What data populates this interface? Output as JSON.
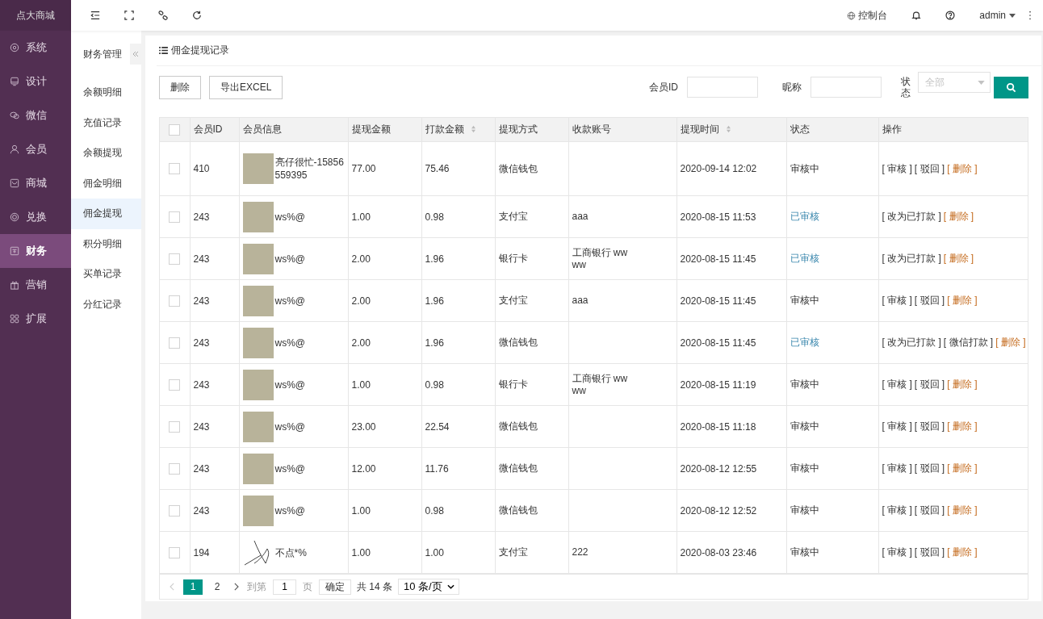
{
  "app": {
    "logo": "点大商城"
  },
  "sidebar": {
    "items": [
      {
        "label": "系统",
        "selected": false
      },
      {
        "label": "设计",
        "selected": false
      },
      {
        "label": "微信",
        "selected": false
      },
      {
        "label": "会员",
        "selected": false
      },
      {
        "label": "商城",
        "selected": false
      },
      {
        "label": "兑换",
        "selected": false
      },
      {
        "label": "财务",
        "selected": true
      },
      {
        "label": "营销",
        "selected": false
      },
      {
        "label": "扩展",
        "selected": false
      }
    ]
  },
  "subnav": {
    "title": "财务管理",
    "items": [
      {
        "label": "余额明细",
        "selected": false
      },
      {
        "label": "充值记录",
        "selected": false
      },
      {
        "label": "余额提现",
        "selected": false
      },
      {
        "label": "佣金明细",
        "selected": false
      },
      {
        "label": "佣金提现",
        "selected": true
      },
      {
        "label": "积分明细",
        "selected": false
      },
      {
        "label": "买单记录",
        "selected": false
      },
      {
        "label": "分红记录",
        "selected": false
      }
    ]
  },
  "topbar": {
    "console": "控制台",
    "user": "admin"
  },
  "page": {
    "title": "佣金提现记录",
    "buttons": [
      "删除",
      "导出EXCEL"
    ],
    "filters": {
      "member_id_label": "会员ID",
      "nickname_label": "昵称",
      "status_label": "状态",
      "status_placeholder": "全部"
    },
    "table": {
      "select_all_checked": false,
      "columns": [
        {
          "label": "会员ID",
          "sortable": false
        },
        {
          "label": "会员信息",
          "sortable": false
        },
        {
          "label": "提现金额",
          "sortable": false
        },
        {
          "label": "打款金额",
          "sortable": true
        },
        {
          "label": "提现方式",
          "sortable": false
        },
        {
          "label": "收款账号",
          "sortable": false
        },
        {
          "label": "提现时间",
          "sortable": true
        },
        {
          "label": "状态",
          "sortable": false
        },
        {
          "label": "操作",
          "sortable": false
        }
      ],
      "rows": [
        {
          "checked": false,
          "member_id": "410",
          "avatar": {
            "kind": "photo"
          },
          "nickname": "亮仔很忙-15856559395",
          "amount": "77.00",
          "paid": "75.46",
          "method": "微信钱包",
          "account": "",
          "time": "2020-09-14 12:02",
          "status": {
            "text": "审核中",
            "kind": "pending"
          },
          "actions": [
            {
              "label": "[ 审核 ]",
              "kind": "normal"
            },
            {
              "label": "[ 驳回 ]",
              "kind": "normal"
            },
            {
              "label": "[ 删除 ]",
              "kind": "danger"
            }
          ]
        },
        {
          "checked": false,
          "member_id": "243",
          "avatar": {
            "kind": "photo"
          },
          "nickname": "ws%@",
          "amount": "1.00",
          "paid": "0.98",
          "method": "支付宝",
          "account": "aaa",
          "time": "2020-08-15 11:53",
          "status": {
            "text": "已审核",
            "kind": "approved"
          },
          "actions": [
            {
              "label": "[ 改为已打款 ]",
              "kind": "normal"
            },
            {
              "label": "[ 删除 ]",
              "kind": "danger"
            }
          ]
        },
        {
          "checked": false,
          "member_id": "243",
          "avatar": {
            "kind": "photo"
          },
          "nickname": "ws%@",
          "amount": "2.00",
          "paid": "1.96",
          "method": "银行卡",
          "account": "工商银行 ww\nww",
          "time": "2020-08-15 11:45",
          "status": {
            "text": "已审核",
            "kind": "approved"
          },
          "actions": [
            {
              "label": "[ 改为已打款 ]",
              "kind": "normal"
            },
            {
              "label": "[ 删除 ]",
              "kind": "danger"
            }
          ]
        },
        {
          "checked": false,
          "member_id": "243",
          "avatar": {
            "kind": "photo"
          },
          "nickname": "ws%@",
          "amount": "2.00",
          "paid": "1.96",
          "method": "支付宝",
          "account": "aaa",
          "time": "2020-08-15 11:45",
          "status": {
            "text": "审核中",
            "kind": "pending"
          },
          "actions": [
            {
              "label": "[ 审核 ]",
              "kind": "normal"
            },
            {
              "label": "[ 驳回 ]",
              "kind": "normal"
            },
            {
              "label": "[ 删除 ]",
              "kind": "danger"
            }
          ]
        },
        {
          "checked": false,
          "member_id": "243",
          "avatar": {
            "kind": "photo"
          },
          "nickname": "ws%@",
          "amount": "2.00",
          "paid": "1.96",
          "method": "微信钱包",
          "account": "",
          "time": "2020-08-15 11:45",
          "status": {
            "text": "已审核",
            "kind": "approved"
          },
          "actions": [
            {
              "label": "[ 改为已打款 ]",
              "kind": "normal"
            },
            {
              "label": "[ 微信打款 ]",
              "kind": "normal"
            },
            {
              "label": "[ 删除 ]",
              "kind": "danger"
            }
          ]
        },
        {
          "checked": false,
          "member_id": "243",
          "avatar": {
            "kind": "photo"
          },
          "nickname": "ws%@",
          "amount": "1.00",
          "paid": "0.98",
          "method": "银行卡",
          "account": "工商银行 ww\nww",
          "time": "2020-08-15 11:19",
          "status": {
            "text": "审核中",
            "kind": "pending"
          },
          "actions": [
            {
              "label": "[ 审核 ]",
              "kind": "normal"
            },
            {
              "label": "[ 驳回 ]",
              "kind": "normal"
            },
            {
              "label": "[ 删除 ]",
              "kind": "danger"
            }
          ]
        },
        {
          "checked": false,
          "member_id": "243",
          "avatar": {
            "kind": "photo"
          },
          "nickname": "ws%@",
          "amount": "23.00",
          "paid": "22.54",
          "method": "微信钱包",
          "account": "",
          "time": "2020-08-15 11:18",
          "status": {
            "text": "审核中",
            "kind": "pending"
          },
          "actions": [
            {
              "label": "[ 审核 ]",
              "kind": "normal"
            },
            {
              "label": "[ 驳回 ]",
              "kind": "normal"
            },
            {
              "label": "[ 删除 ]",
              "kind": "danger"
            }
          ]
        },
        {
          "checked": false,
          "member_id": "243",
          "avatar": {
            "kind": "photo"
          },
          "nickname": "ws%@",
          "amount": "12.00",
          "paid": "11.76",
          "method": "微信钱包",
          "account": "",
          "time": "2020-08-12 12:55",
          "status": {
            "text": "审核中",
            "kind": "pending"
          },
          "actions": [
            {
              "label": "[ 审核 ]",
              "kind": "normal"
            },
            {
              "label": "[ 驳回 ]",
              "kind": "normal"
            },
            {
              "label": "[ 删除 ]",
              "kind": "danger"
            }
          ]
        },
        {
          "checked": false,
          "member_id": "243",
          "avatar": {
            "kind": "photo"
          },
          "nickname": "ws%@",
          "amount": "1.00",
          "paid": "0.98",
          "method": "微信钱包",
          "account": "",
          "time": "2020-08-12 12:52",
          "status": {
            "text": "审核中",
            "kind": "pending"
          },
          "actions": [
            {
              "label": "[ 审核 ]",
              "kind": "normal"
            },
            {
              "label": "[ 驳回 ]",
              "kind": "normal"
            },
            {
              "label": "[ 删除 ]",
              "kind": "danger"
            }
          ]
        },
        {
          "checked": false,
          "member_id": "194",
          "avatar": {
            "kind": "sketch"
          },
          "nickname": "不点*%",
          "amount": "1.00",
          "paid": "1.00",
          "method": "支付宝",
          "account": "222",
          "time": "2020-08-03 23:46",
          "status": {
            "text": "审核中",
            "kind": "pending"
          },
          "actions": [
            {
              "label": "[ 审核 ]",
              "kind": "normal"
            },
            {
              "label": "[ 驳回 ]",
              "kind": "normal"
            },
            {
              "label": "[ 删除 ]",
              "kind": "danger"
            }
          ]
        }
      ]
    },
    "pagination": {
      "prev_disabled": true,
      "pages": [
        {
          "label": "1",
          "selected": true
        },
        {
          "label": "2",
          "selected": false
        }
      ],
      "goto_label": "到第",
      "goto_value": "1",
      "page_unit": "页",
      "confirm": "确定",
      "total": "共 14 条",
      "page_size": "10 条/页"
    }
  }
}
